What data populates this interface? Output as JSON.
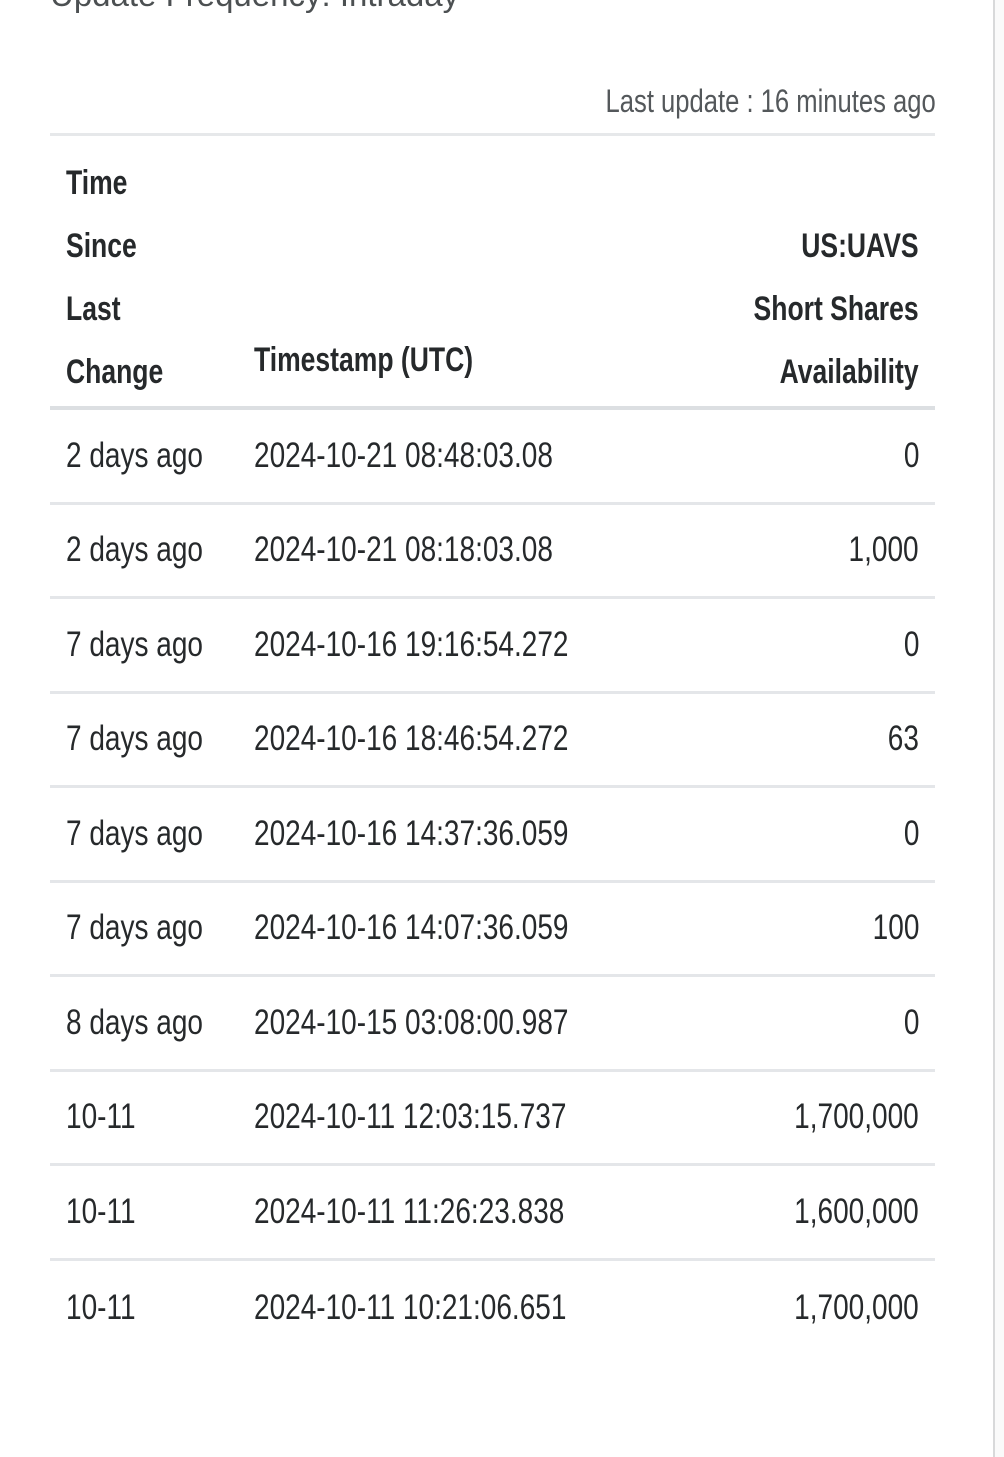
{
  "header": {
    "frequency_title": "Update Frequency: Intraday",
    "last_update": "Last update : 16 minutes ago"
  },
  "table": {
    "columns": {
      "time_since_last_change": "Time\nSince\nLast\nChange",
      "timestamp": "Timestamp (UTC)",
      "availability": "US:UAVS\nShort Shares\nAvailability"
    },
    "rows": [
      {
        "since": "2 days ago",
        "timestamp": "2024-10-21 08:48:03.08",
        "value": "0"
      },
      {
        "since": "2 days ago",
        "timestamp": "2024-10-21 08:18:03.08",
        "value": "1,000"
      },
      {
        "since": "7 days ago",
        "timestamp": "2024-10-16 19:16:54.272",
        "value": "0"
      },
      {
        "since": "7 days ago",
        "timestamp": "2024-10-16 18:46:54.272",
        "value": "63"
      },
      {
        "since": "7 days ago",
        "timestamp": "2024-10-16 14:37:36.059",
        "value": "0"
      },
      {
        "since": "7 days ago",
        "timestamp": "2024-10-16 14:07:36.059",
        "value": "100"
      },
      {
        "since": "8 days ago",
        "timestamp": "2024-10-15 03:08:00.987",
        "value": "0"
      },
      {
        "since": "10-11",
        "timestamp": "2024-10-11 12:03:15.737",
        "value": "1,700,000"
      },
      {
        "since": "10-11",
        "timestamp": "2024-10-11 11:26:23.838",
        "value": "1,600,000"
      },
      {
        "since": "10-11",
        "timestamp": "2024-10-11 10:21:06.651",
        "value": "1,700,000"
      }
    ]
  },
  "colors": {
    "text": "#26292b",
    "muted_text": "#54585b",
    "divider": "#e4e6e9",
    "header_divider": "#dcdfe2",
    "background": "#ffffff"
  }
}
